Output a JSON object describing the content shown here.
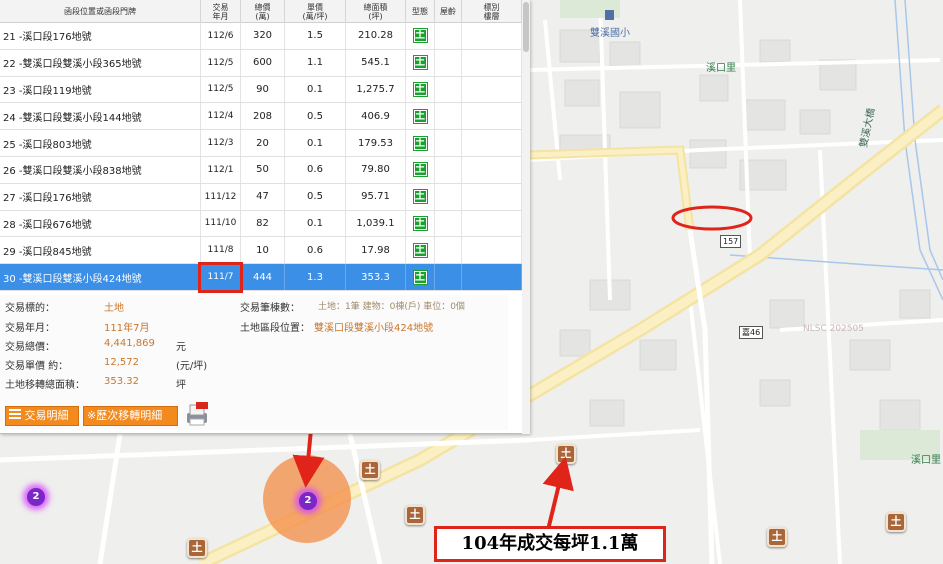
{
  "table": {
    "headers": [
      "函段位置或函段門牌",
      "交易\n年月",
      "總價\n(萬)",
      "單價\n(萬/坪)",
      "總面積\n(坪)",
      "型態",
      "屋齡",
      "標別\n樓層"
    ],
    "rows": [
      {
        "no": "21",
        "address": "-溪口段176地號",
        "date": "112/6",
        "total": "320",
        "unit": "1.5",
        "area": "210.28",
        "type": "土"
      },
      {
        "no": "22",
        "address": "-雙溪口段雙溪小段365地號",
        "date": "112/5",
        "total": "600",
        "unit": "1.1",
        "area": "545.1",
        "type": "土"
      },
      {
        "no": "23",
        "address": "-溪口段119地號",
        "date": "112/5",
        "total": "90",
        "unit": "0.1",
        "area": "1,275.7",
        "type": "土"
      },
      {
        "no": "24",
        "address": "-雙溪口段雙溪小段144地號",
        "date": "112/4",
        "total": "208",
        "unit": "0.5",
        "area": "406.9",
        "type": "土"
      },
      {
        "no": "25",
        "address": "-溪口段803地號",
        "date": "112/3",
        "total": "20",
        "unit": "0.1",
        "area": "179.53",
        "type": "土"
      },
      {
        "no": "26",
        "address": "-雙溪口段雙溪小段838地號",
        "date": "112/1",
        "total": "50",
        "unit": "0.6",
        "area": "79.80",
        "type": "土"
      },
      {
        "no": "27",
        "address": "-溪口段176地號",
        "date": "111/12",
        "total": "47",
        "unit": "0.5",
        "area": "95.71",
        "type": "土"
      },
      {
        "no": "28",
        "address": "-溪口段676地號",
        "date": "111/10",
        "total": "82",
        "unit": "0.1",
        "area": "1,039.1",
        "type": "土"
      },
      {
        "no": "29",
        "address": "-溪口段845地號",
        "date": "111/8",
        "total": "10",
        "unit": "0.6",
        "area": "17.98",
        "type": "土"
      },
      {
        "no": "30",
        "address": "-雙溪口段雙溪小段424地號",
        "date": "111/7",
        "total": "444",
        "unit": "1.3",
        "area": "353.3",
        "type": "土"
      }
    ]
  },
  "detail": {
    "target_label": "交易標的：",
    "target_value": "土地",
    "date_label": "交易年月：",
    "date_value": "111年7月",
    "total_label": "交易總價：",
    "total_value": "4,441,869",
    "total_unit": "元",
    "unit_label": "交易單價 約：",
    "unit_value": "12,572",
    "unit_unit": "(元/坪)",
    "area_label": "土地移轉總面積：",
    "area_value": "353.32",
    "area_unit": "坪",
    "count_label": "交易筆棟數：",
    "count_value": "土地：1筆 建物：0棟(戶) 車位：0個",
    "location_label": "土地區段位置：",
    "location_value": "雙溪口段雙溪小段424地號"
  },
  "buttons": {
    "detail": "交易明細",
    "history": "※歷次移轉明細"
  },
  "map": {
    "labels": {
      "school": "雙溪國小",
      "village1": "溪口里",
      "village2": "溪口里",
      "bridge": "雙溪大橋",
      "route157": "157",
      "route46": "嘉46",
      "watermark": "NLSC 202505"
    },
    "cluster_big": "2",
    "cluster_small": "2",
    "marker_glyph": "土",
    "annotation": "104年成交每坪1.1萬"
  },
  "colors": {
    "selected_row": "#3b8fe6",
    "highlight_red": "#e0241a",
    "land_icon_green": "#19a12d",
    "detail_value": "#c8762a",
    "button_orange": "#f28a1e",
    "marker_brown": "#a9663a",
    "cluster_purple": "#7b27c8"
  }
}
